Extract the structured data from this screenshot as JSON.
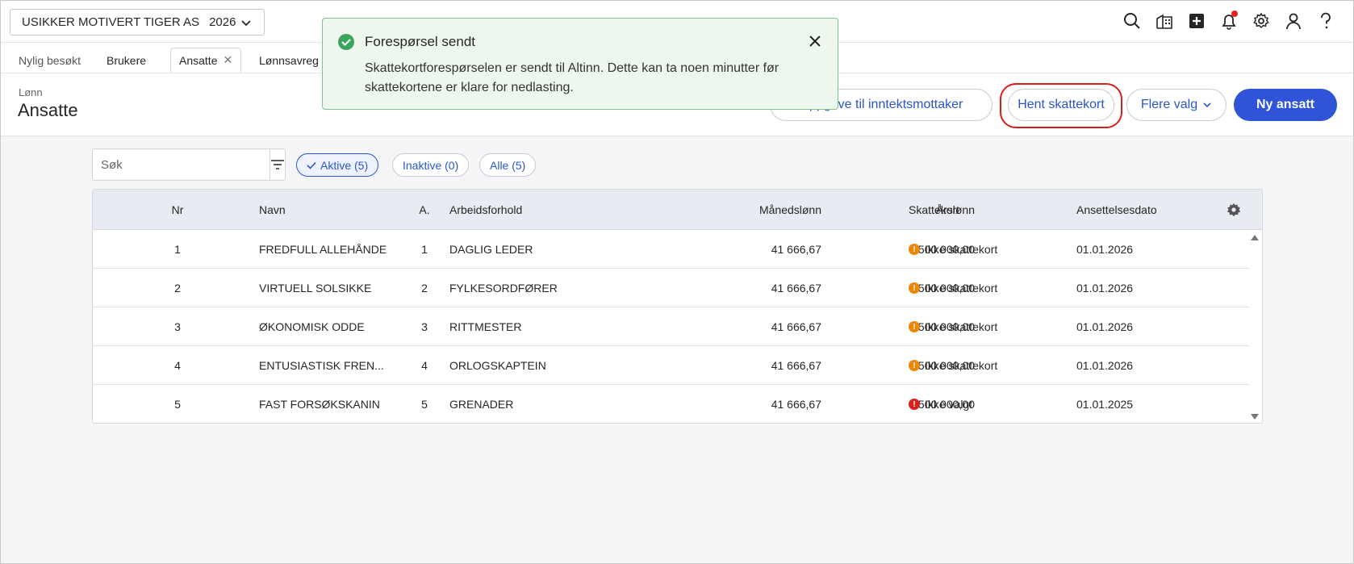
{
  "topbar": {
    "company": "USIKKER MOTIVERT TIGER AS",
    "year": "2026"
  },
  "tabs": {
    "recent_label": "Nylig besøkt",
    "items": [
      {
        "label": "Brukere"
      },
      {
        "label": "Ansatte"
      },
      {
        "label": "Lønnsavreg"
      }
    ]
  },
  "header": {
    "breadcrumb": "Lønn",
    "title": "Ansatte",
    "btn_oppgave": "Oppgave til inntektsmottaker",
    "btn_hent": "Hent skattekort",
    "btn_flere": "Flere valg",
    "btn_ny": "Ny ansatt"
  },
  "toast": {
    "title": "Forespørsel sendt",
    "message": "Skattekortforespørselen er sendt til Altinn. Dette kan ta noen minutter før skattekortene er klare for nedlasting."
  },
  "filters": {
    "search_placeholder": "Søk",
    "chips": [
      {
        "label": "Aktive (5)",
        "active": true
      },
      {
        "label": "Inaktive (0)",
        "active": false
      },
      {
        "label": "Alle (5)",
        "active": false
      }
    ]
  },
  "table": {
    "columns": [
      "Nr",
      "Navn",
      "A.",
      "Arbeidsforhold",
      "Månedslønn",
      "Årslønn",
      "Skattekort",
      "Ansettelsesdato"
    ],
    "rows": [
      {
        "nr": "1",
        "navn": "FREDFULL ALLEHÅNDE",
        "a": "1",
        "arbeidsforhold": "DAGLIG LEDER",
        "maanedslonn": "41 666,67",
        "aarslonn": "500 000,00",
        "skattekort": "Ikke skattekort",
        "status": "warning",
        "dato": "01.01.2026"
      },
      {
        "nr": "2",
        "navn": "VIRTUELL SOLSIKKE",
        "a": "2",
        "arbeidsforhold": "FYLKESORDFØRER",
        "maanedslonn": "41 666,67",
        "aarslonn": "500 000,00",
        "skattekort": "Ikke skattekort",
        "status": "warning",
        "dato": "01.01.2026"
      },
      {
        "nr": "3",
        "navn": "ØKONOMISK ODDE",
        "a": "3",
        "arbeidsforhold": "RITTMESTER",
        "maanedslonn": "41 666,67",
        "aarslonn": "500 000,00",
        "skattekort": "Ikke skattekort",
        "status": "warning",
        "dato": "01.01.2026"
      },
      {
        "nr": "4",
        "navn": "ENTUSIASTISK FREN...",
        "a": "4",
        "arbeidsforhold": "ORLOGSKAPTEIN",
        "maanedslonn": "41 666,67",
        "aarslonn": "500 000,00",
        "skattekort": "Ikke skattekort",
        "status": "warning",
        "dato": "01.01.2026"
      },
      {
        "nr": "5",
        "navn": "FAST FORSØKSKANIN",
        "a": "5",
        "arbeidsforhold": "GRENADER",
        "maanedslonn": "41 666,67",
        "aarslonn": "500 000,00",
        "skattekort": "Ikke valgt",
        "status": "error",
        "dato": "01.01.2025"
      }
    ]
  },
  "colors": {
    "primary": "#2f54d8",
    "warning": "#e8890c",
    "error": "#d8231d",
    "success": "#3aa55b"
  }
}
